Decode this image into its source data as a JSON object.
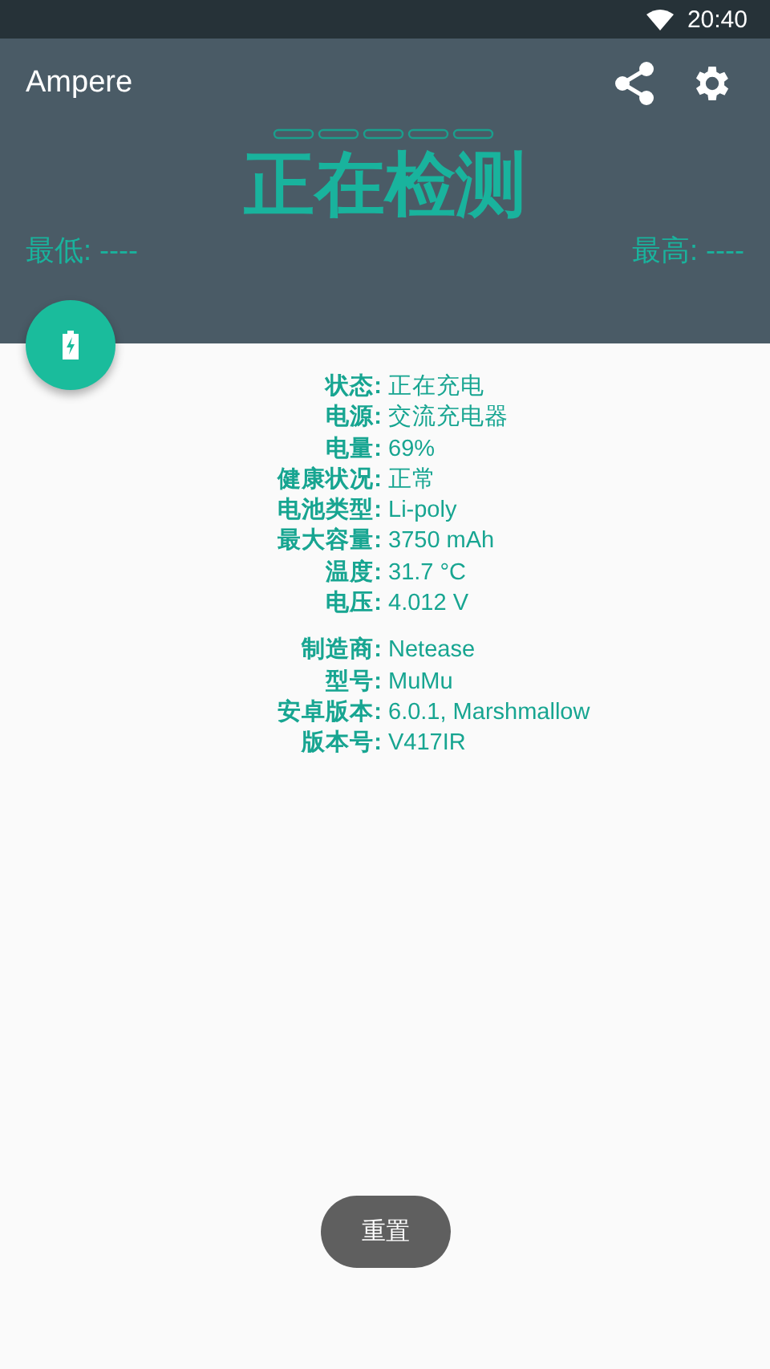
{
  "status_bar": {
    "time": "20:40"
  },
  "app_bar": {
    "title": "Ampere"
  },
  "header": {
    "reading": "正在检测",
    "min": "最低: ----",
    "max": "最高: ----"
  },
  "info_groups": [
    {
      "rows": [
        {
          "label": "状态:",
          "value": "正在充电"
        },
        {
          "label": "电源:",
          "value": "交流充电器"
        },
        {
          "label": "电量:",
          "value": "69%"
        },
        {
          "label": "健康状况:",
          "value": "正常"
        },
        {
          "label": "电池类型:",
          "value": "Li-poly"
        },
        {
          "label": "最大容量:",
          "value": "3750 mAh"
        },
        {
          "label": "温度:",
          "value": "31.7 °C"
        },
        {
          "label": "电压:",
          "value": "4.012 V"
        }
      ]
    },
    {
      "rows": [
        {
          "label": "制造商:",
          "value": "Netease"
        },
        {
          "label": "型号:",
          "value": "MuMu"
        },
        {
          "label": "安卓版本:",
          "value": "6.0.1, Marshmallow"
        },
        {
          "label": "版本号:",
          "value": "V417IR"
        }
      ]
    }
  ],
  "toast": {
    "text": "重置"
  }
}
